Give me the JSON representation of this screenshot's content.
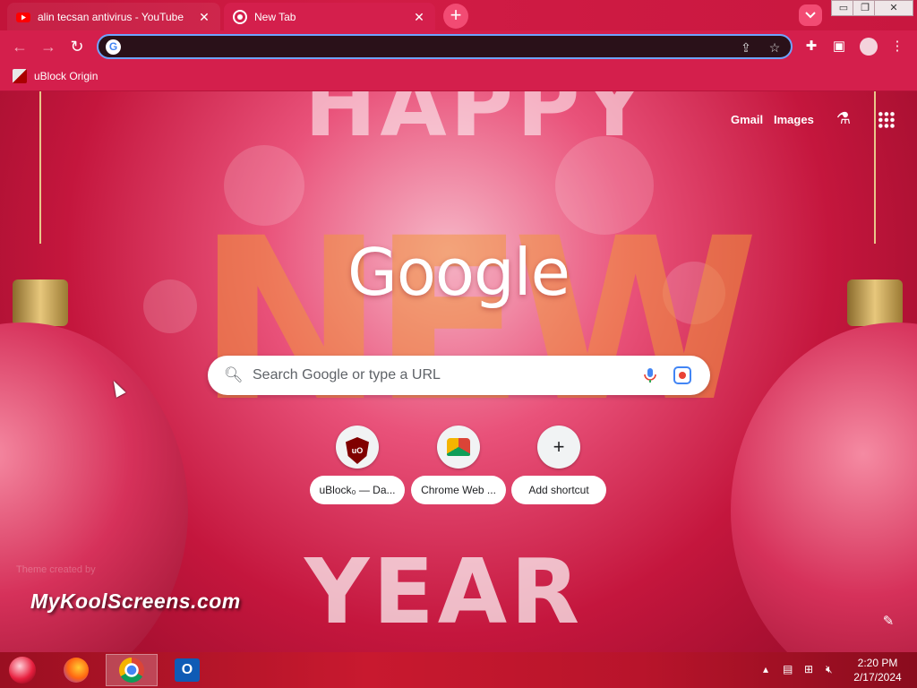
{
  "tabs": [
    {
      "title": "alin tecsan antivirus - YouTube",
      "favicon": "youtube-icon",
      "active": false
    },
    {
      "title": "New Tab",
      "favicon": "chrome-icon",
      "active": true
    }
  ],
  "window_controls": {
    "minimize": "▭",
    "maximize": "❐",
    "close": "✕"
  },
  "bookmarks": [
    {
      "label": "uBlock Origin",
      "icon": "ublock-icon"
    }
  ],
  "ntp": {
    "top_links": {
      "gmail": "Gmail",
      "images": "Images"
    },
    "logo": "Google",
    "search": {
      "placeholder": "Search Google or type a URL",
      "value": ""
    },
    "shortcuts": [
      {
        "label": "uBlock₀ — Da...",
        "icon": "ublock-icon"
      },
      {
        "label": "Chrome Web ...",
        "icon": "chrome-web-store-icon"
      },
      {
        "label": "Add shortcut",
        "icon": "plus-icon",
        "glyph": "+"
      }
    ],
    "theme_credit": "Theme created by",
    "watermark": "MyKoolScreens.com",
    "background_text": {
      "top": "HAPPY",
      "middle": "NEW",
      "bottom": "YEAR"
    }
  },
  "taskbar": {
    "apps": [
      {
        "name": "Firefox",
        "icon": "firefox-icon",
        "active": false
      },
      {
        "name": "Google Chrome",
        "icon": "chrome-icon",
        "active": true
      },
      {
        "name": "Outlook",
        "icon": "outlook-icon",
        "active": false
      }
    ],
    "clock": {
      "time": "2:20 PM",
      "date": "2/17/2024"
    }
  },
  "colors": {
    "accent": "#d41f4c",
    "omnibox_border": "#6fa4ff"
  }
}
